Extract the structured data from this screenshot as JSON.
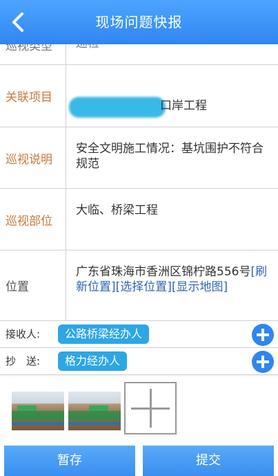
{
  "header": {
    "title": "现场问题快报"
  },
  "form": {
    "inspection_type": {
      "label": "巡视类型",
      "value": "巡检"
    },
    "project": {
      "label": "关联项目",
      "value": "口岸工程"
    },
    "description": {
      "label": "巡视说明",
      "value": "安全文明施工情况：基坑围护不符合规范"
    },
    "location_part": {
      "label": "巡视部位",
      "value": "大临、桥梁工程"
    },
    "position": {
      "label": "位置",
      "address": "广东省珠海市香洲区锦柠路556号",
      "refresh": "[刷新位置]",
      "choose": "[选择位置]",
      "show_map": "[显示地图]"
    }
  },
  "receivers": {
    "label": "接收人:",
    "chip": "公路桥梁经办人"
  },
  "cc": {
    "label": "抄　送:",
    "chip": "格力经办人"
  },
  "footer": {
    "save": "暂存",
    "submit": "提交"
  }
}
